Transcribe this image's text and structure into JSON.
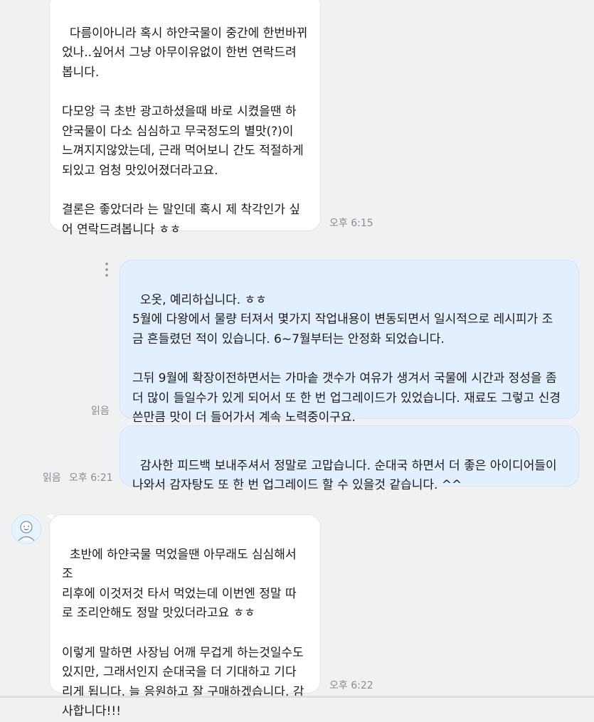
{
  "messages": [
    {
      "id": "m1",
      "direction": "incoming",
      "text": "다름이아니라 혹시 하얀국물이 중간에 한번바뀌\n었나..싶어서 그냥 아무이유없이 한번 연락드려\n봅니다.\n\n다모앙 극 초반 광고하셨을때 바로 시켰을땐 하\n얀국물이 다소 심심하고 무국정도의 별맛(?)이\n느껴지지않았는데, 근래 먹어보니 간도 적절하게\n되있고 엄청 맛있어졌더라고요.\n\n결론은 좋았더라 는 말인데 혹시 제 착각인가 싶\n어 연락드려봅니다 ㅎㅎ",
      "time": "오후 6:15"
    },
    {
      "id": "m2",
      "direction": "outgoing",
      "text": "오옷, 예리하십니다. ㅎㅎ\n5월에 다왕에서 물량 터져서 몇가지 작업내용이 변동되면서 일시적으로 레시피가 조\n금 흔들렸던 적이 있습니다. 6~7월부터는 안정화 되었습니다.\n\n그뒤 9월에 확장이전하면서는 가마솥 갯수가 여유가 생겨서 국물에 시간과 정성을 좀\n더 많이 들일수가 있게 되어서 또 한 번 업그레이드가 있었습니다. 재료도 그렇고 신경\n쓴만큼 맛이 더 들어가서 계속 노력중이구요.",
      "read": "읽음"
    },
    {
      "id": "m3",
      "direction": "outgoing",
      "text": "감사한 피드백 보내주셔서 정말로 고맙습니다. 순대국 하면서 더 좋은 아이디어들이\n나와서 감자탕도 또 한 번 업그레이드 할 수 있을것 같습니다. ^^",
      "read": "읽음",
      "time": "오후 6:21"
    },
    {
      "id": "m4",
      "direction": "incoming",
      "text": "초반에 하얀국물 먹었을땐 아무래도 심심해서 조\n리후에 이것저것 타서 먹었는데 이번엔 정말 따\n로 조리안해도 정말 맛있더라고요 ㅎㅎ\n\n이렇게 말하면 사장님 어깨 무겁게 하는것일수도\n있지만, 그래서인지 순대국을 더 기대하고 기다\n리게 됩니다. 늘 응원하고 잘 구매하겠습니다. 감\n사합니다!!!",
      "time": "오후 6:22"
    }
  ],
  "icons": {
    "more_menu": "more-vertical-icon",
    "avatar": "smiley-avatar-icon"
  },
  "colors": {
    "background": "#f0f1f3",
    "incoming_bubble": "#ffffff",
    "outgoing_bubble": "#e3efff",
    "meta_text": "#888c92"
  }
}
